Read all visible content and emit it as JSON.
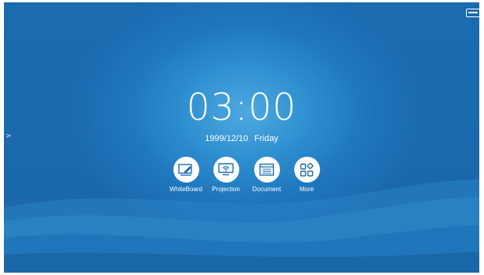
{
  "clock": {
    "time": "03:00"
  },
  "date": {
    "date": "1999/12/10",
    "weekday": "Friday"
  },
  "apps": [
    {
      "label": "WhiteBoard",
      "icon": "whiteboard-icon"
    },
    {
      "label": "Projection",
      "icon": "projection-icon"
    },
    {
      "label": "Document",
      "icon": "document-icon"
    },
    {
      "label": "More",
      "icon": "more-apps-icon"
    }
  ],
  "top_right": {
    "icon": "window-icon"
  },
  "side": {
    "icon": "chevron-right-icon",
    "glyph": ">"
  },
  "colors": {
    "background": "#1a6bb0",
    "glow": "#4ea9e0",
    "icon_fill": "#1a6bb0",
    "text": "#ffffff"
  }
}
